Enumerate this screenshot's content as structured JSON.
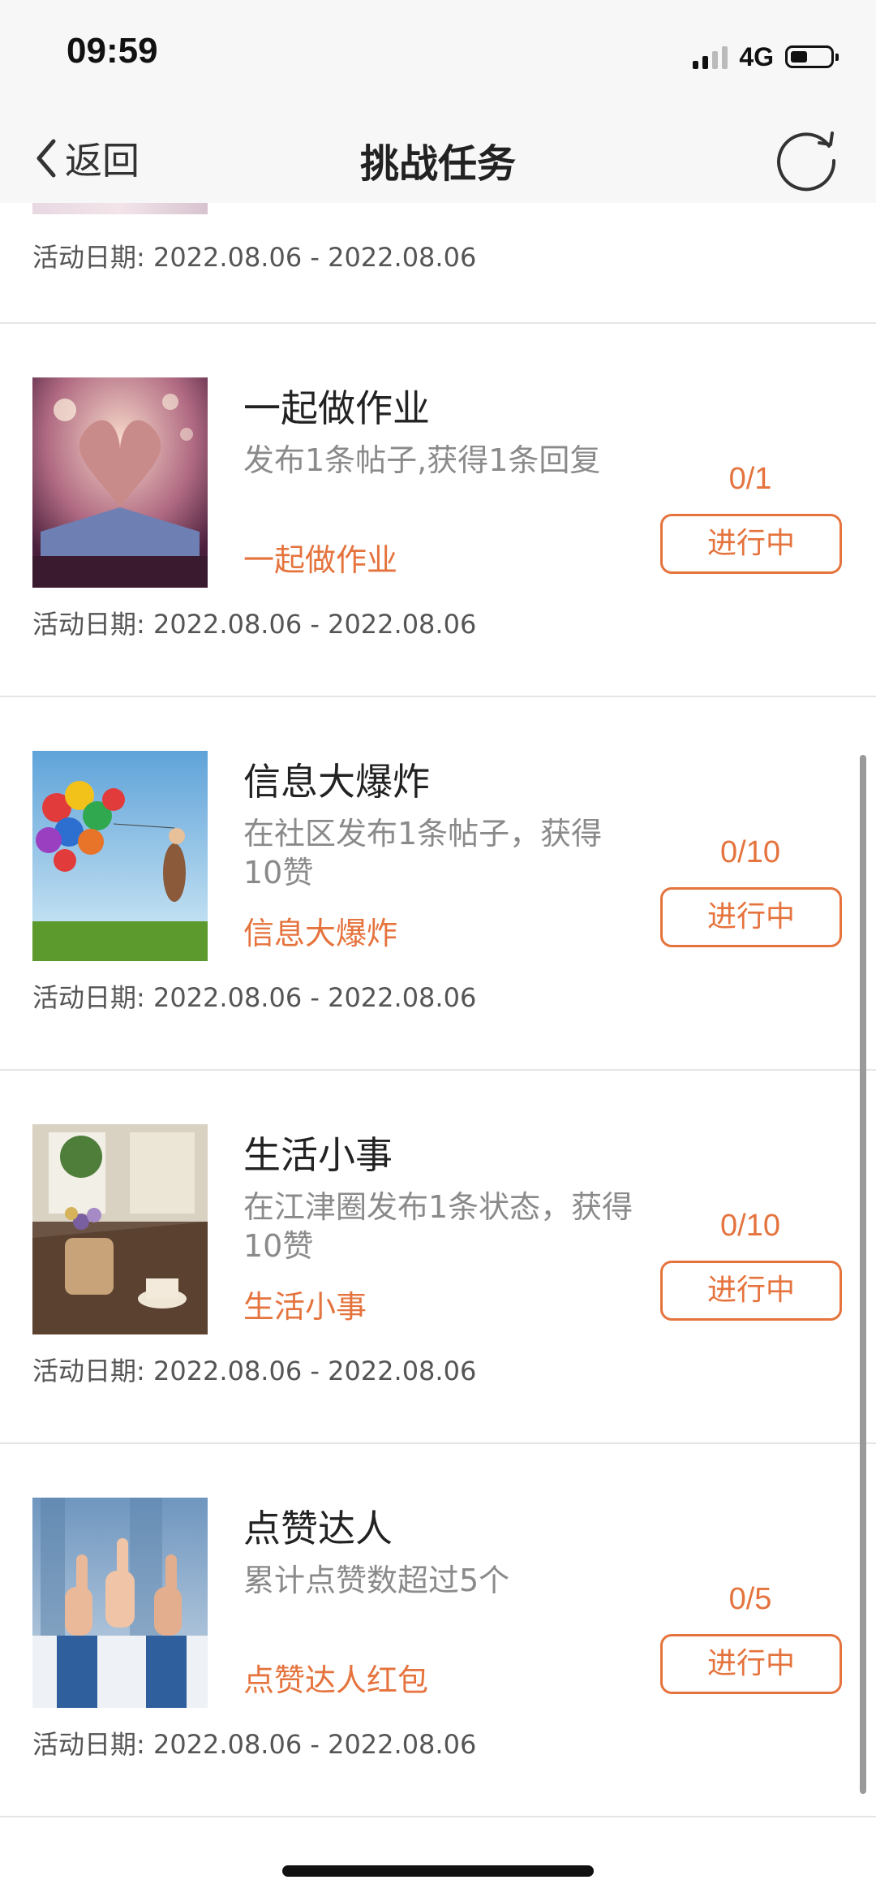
{
  "status_bar": {
    "time": "09:59",
    "network": "4G"
  },
  "nav": {
    "back_label": "返回",
    "title": "挑战任务",
    "refresh_icon": "refresh-icon"
  },
  "first_partial": {
    "date_label": "活动日期:",
    "date_range": "2022.08.06 - 2022.08.06"
  },
  "tasks": [
    {
      "title": "一起做作业",
      "description": "发布1条帖子,获得1条回复",
      "reward": "一起做作业",
      "progress": "0/1",
      "status": "进行中",
      "date_label": "活动日期:",
      "date_range": "2022.08.06 - 2022.08.06",
      "image": "heart-book-image"
    },
    {
      "title": "信息大爆炸",
      "description": "在社区发布1条帖子，获得10赞",
      "reward": "信息大爆炸",
      "progress": "0/10",
      "status": "进行中",
      "date_label": "活动日期:",
      "date_range": "2022.08.06 - 2022.08.06",
      "image": "balloons-image"
    },
    {
      "title": "生活小事",
      "description": "在江津圈发布1条状态，获得10赞",
      "reward": "生活小事",
      "progress": "0/10",
      "status": "进行中",
      "date_label": "活动日期:",
      "date_range": "2022.08.06 - 2022.08.06",
      "image": "tabletop-flowers-image"
    },
    {
      "title": "点赞达人",
      "description": "累计点赞数超过5个",
      "reward": "点赞达人红包",
      "progress": "0/5",
      "status": "进行中",
      "date_label": "活动日期:",
      "date_range": "2022.08.06 - 2022.08.06",
      "image": "thumbs-up-image"
    }
  ],
  "colors": {
    "accent": "#e5733d",
    "description": "#8a8a8a",
    "divider": "#e5e5e5",
    "bar_background": "#f7f7f7"
  }
}
